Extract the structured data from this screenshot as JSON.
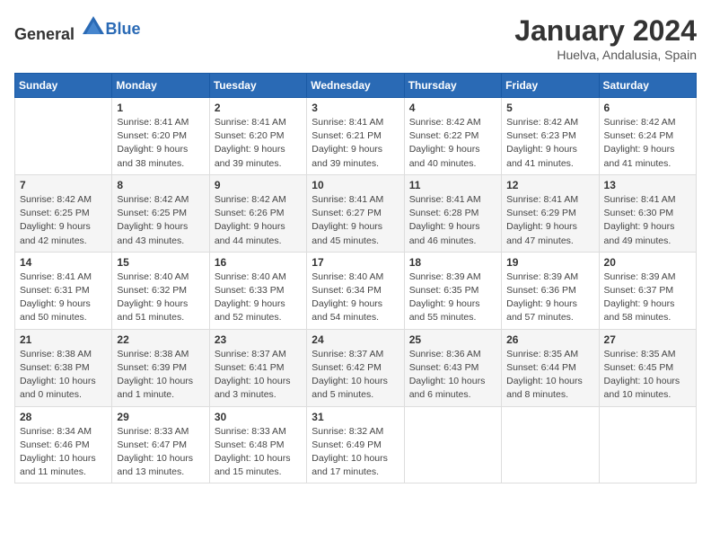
{
  "header": {
    "logo_general": "General",
    "logo_blue": "Blue",
    "month": "January 2024",
    "location": "Huelva, Andalusia, Spain"
  },
  "weekdays": [
    "Sunday",
    "Monday",
    "Tuesday",
    "Wednesday",
    "Thursday",
    "Friday",
    "Saturday"
  ],
  "weeks": [
    [
      {
        "day": "",
        "info": ""
      },
      {
        "day": "1",
        "info": "Sunrise: 8:41 AM\nSunset: 6:20 PM\nDaylight: 9 hours\nand 38 minutes."
      },
      {
        "day": "2",
        "info": "Sunrise: 8:41 AM\nSunset: 6:20 PM\nDaylight: 9 hours\nand 39 minutes."
      },
      {
        "day": "3",
        "info": "Sunrise: 8:41 AM\nSunset: 6:21 PM\nDaylight: 9 hours\nand 39 minutes."
      },
      {
        "day": "4",
        "info": "Sunrise: 8:42 AM\nSunset: 6:22 PM\nDaylight: 9 hours\nand 40 minutes."
      },
      {
        "day": "5",
        "info": "Sunrise: 8:42 AM\nSunset: 6:23 PM\nDaylight: 9 hours\nand 41 minutes."
      },
      {
        "day": "6",
        "info": "Sunrise: 8:42 AM\nSunset: 6:24 PM\nDaylight: 9 hours\nand 41 minutes."
      }
    ],
    [
      {
        "day": "7",
        "info": "Sunrise: 8:42 AM\nSunset: 6:25 PM\nDaylight: 9 hours\nand 42 minutes."
      },
      {
        "day": "8",
        "info": "Sunrise: 8:42 AM\nSunset: 6:25 PM\nDaylight: 9 hours\nand 43 minutes."
      },
      {
        "day": "9",
        "info": "Sunrise: 8:42 AM\nSunset: 6:26 PM\nDaylight: 9 hours\nand 44 minutes."
      },
      {
        "day": "10",
        "info": "Sunrise: 8:41 AM\nSunset: 6:27 PM\nDaylight: 9 hours\nand 45 minutes."
      },
      {
        "day": "11",
        "info": "Sunrise: 8:41 AM\nSunset: 6:28 PM\nDaylight: 9 hours\nand 46 minutes."
      },
      {
        "day": "12",
        "info": "Sunrise: 8:41 AM\nSunset: 6:29 PM\nDaylight: 9 hours\nand 47 minutes."
      },
      {
        "day": "13",
        "info": "Sunrise: 8:41 AM\nSunset: 6:30 PM\nDaylight: 9 hours\nand 49 minutes."
      }
    ],
    [
      {
        "day": "14",
        "info": "Sunrise: 8:41 AM\nSunset: 6:31 PM\nDaylight: 9 hours\nand 50 minutes."
      },
      {
        "day": "15",
        "info": "Sunrise: 8:40 AM\nSunset: 6:32 PM\nDaylight: 9 hours\nand 51 minutes."
      },
      {
        "day": "16",
        "info": "Sunrise: 8:40 AM\nSunset: 6:33 PM\nDaylight: 9 hours\nand 52 minutes."
      },
      {
        "day": "17",
        "info": "Sunrise: 8:40 AM\nSunset: 6:34 PM\nDaylight: 9 hours\nand 54 minutes."
      },
      {
        "day": "18",
        "info": "Sunrise: 8:39 AM\nSunset: 6:35 PM\nDaylight: 9 hours\nand 55 minutes."
      },
      {
        "day": "19",
        "info": "Sunrise: 8:39 AM\nSunset: 6:36 PM\nDaylight: 9 hours\nand 57 minutes."
      },
      {
        "day": "20",
        "info": "Sunrise: 8:39 AM\nSunset: 6:37 PM\nDaylight: 9 hours\nand 58 minutes."
      }
    ],
    [
      {
        "day": "21",
        "info": "Sunrise: 8:38 AM\nSunset: 6:38 PM\nDaylight: 10 hours\nand 0 minutes."
      },
      {
        "day": "22",
        "info": "Sunrise: 8:38 AM\nSunset: 6:39 PM\nDaylight: 10 hours\nand 1 minute."
      },
      {
        "day": "23",
        "info": "Sunrise: 8:37 AM\nSunset: 6:41 PM\nDaylight: 10 hours\nand 3 minutes."
      },
      {
        "day": "24",
        "info": "Sunrise: 8:37 AM\nSunset: 6:42 PM\nDaylight: 10 hours\nand 5 minutes."
      },
      {
        "day": "25",
        "info": "Sunrise: 8:36 AM\nSunset: 6:43 PM\nDaylight: 10 hours\nand 6 minutes."
      },
      {
        "day": "26",
        "info": "Sunrise: 8:35 AM\nSunset: 6:44 PM\nDaylight: 10 hours\nand 8 minutes."
      },
      {
        "day": "27",
        "info": "Sunrise: 8:35 AM\nSunset: 6:45 PM\nDaylight: 10 hours\nand 10 minutes."
      }
    ],
    [
      {
        "day": "28",
        "info": "Sunrise: 8:34 AM\nSunset: 6:46 PM\nDaylight: 10 hours\nand 11 minutes."
      },
      {
        "day": "29",
        "info": "Sunrise: 8:33 AM\nSunset: 6:47 PM\nDaylight: 10 hours\nand 13 minutes."
      },
      {
        "day": "30",
        "info": "Sunrise: 8:33 AM\nSunset: 6:48 PM\nDaylight: 10 hours\nand 15 minutes."
      },
      {
        "day": "31",
        "info": "Sunrise: 8:32 AM\nSunset: 6:49 PM\nDaylight: 10 hours\nand 17 minutes."
      },
      {
        "day": "",
        "info": ""
      },
      {
        "day": "",
        "info": ""
      },
      {
        "day": "",
        "info": ""
      }
    ]
  ]
}
